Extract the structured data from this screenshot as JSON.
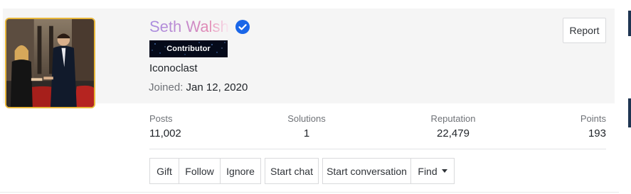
{
  "profile": {
    "username": "Seth Walsh",
    "rank_badge": "Contributor",
    "user_title": "Iconoclast",
    "joined_label": "Joined:",
    "joined_value": "Jan 12, 2020",
    "report_label": "Report",
    "avatar_icon": "profile-photo",
    "verified_icon": "verified-check-icon",
    "username_color_start": "#a98ee0",
    "username_color_end": "#e38ab4",
    "avatar_border_color": "#e8b73a",
    "verified_color": "#1a66e8"
  },
  "stats": [
    {
      "label": "Posts",
      "value": "11,002"
    },
    {
      "label": "Solutions",
      "value": "1"
    },
    {
      "label": "Reputation",
      "value": "22,479"
    },
    {
      "label": "Points",
      "value": "193"
    }
  ],
  "actions": {
    "gift": "Gift",
    "follow": "Follow",
    "ignore": "Ignore",
    "start_chat": "Start chat",
    "start_conversation": "Start conversation",
    "find": "Find"
  }
}
